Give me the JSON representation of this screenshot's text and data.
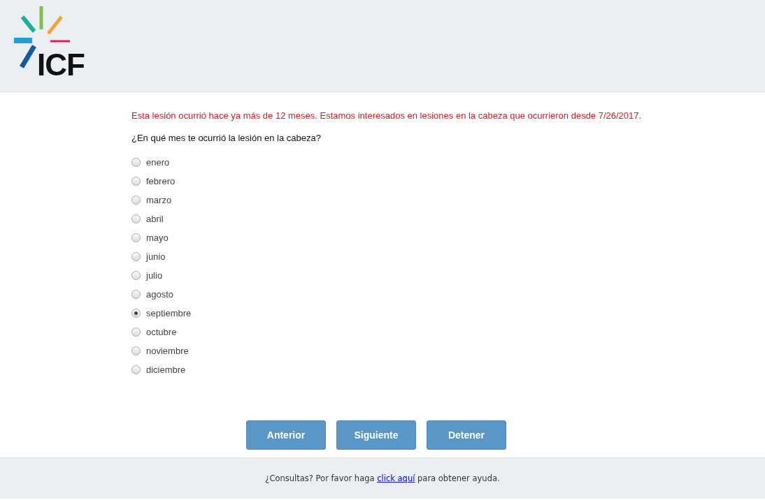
{
  "logo": {
    "text": "ICF"
  },
  "warning": "Esta lesión ocurrió hace ya más de 12 meses. Estamos interesados en lesiones en la cabeza que ocurrieron desde 7/26/2017.",
  "question": "¿En qué mes te ocurrió la lesión en la cabeza?",
  "options": [
    {
      "label": "enero",
      "selected": false
    },
    {
      "label": "febrero",
      "selected": false
    },
    {
      "label": "marzo",
      "selected": false
    },
    {
      "label": "abril",
      "selected": false
    },
    {
      "label": "mayo",
      "selected": false
    },
    {
      "label": "junio",
      "selected": false
    },
    {
      "label": "julio",
      "selected": false
    },
    {
      "label": "agosto",
      "selected": false
    },
    {
      "label": "septiembre",
      "selected": true
    },
    {
      "label": "octubre",
      "selected": false
    },
    {
      "label": "noviembre",
      "selected": false
    },
    {
      "label": "diciembre",
      "selected": false
    }
  ],
  "buttons": [
    "Anterior",
    "Siguiente",
    "Detener"
  ],
  "footer": {
    "before": "¿Consultas? Por favor haga ",
    "link": "click aquí",
    "after": " para obtener ayuda."
  }
}
